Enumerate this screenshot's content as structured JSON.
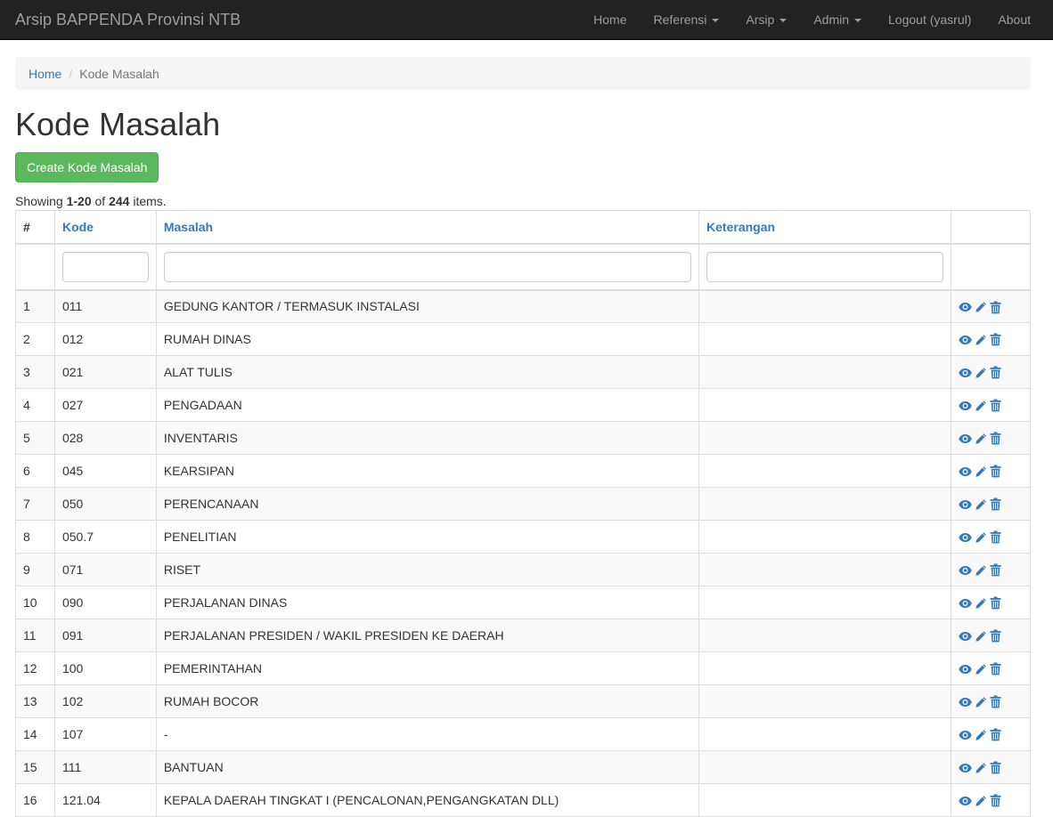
{
  "app": {
    "brand": "Arsip BAPPENDA Provinsi NTB"
  },
  "nav": {
    "items": [
      {
        "label": "Home",
        "dropdown": false
      },
      {
        "label": "Referensi",
        "dropdown": true
      },
      {
        "label": "Arsip",
        "dropdown": true
      },
      {
        "label": "Admin",
        "dropdown": true
      },
      {
        "label": "Logout (yasrul)",
        "dropdown": false
      },
      {
        "label": "About",
        "dropdown": false
      }
    ]
  },
  "breadcrumb": {
    "home": "Home",
    "separator": "/",
    "current": "Kode Masalah"
  },
  "page": {
    "title": "Kode Masalah",
    "create_label": "Create Kode Masalah"
  },
  "summary": {
    "prefix": "Showing ",
    "range": "1-20",
    "of": " of ",
    "total": "244",
    "suffix": " items."
  },
  "table": {
    "headers": {
      "num": "#",
      "kode": "Kode",
      "masalah": "Masalah",
      "keterangan": "Keterangan"
    },
    "rows": [
      {
        "num": "1",
        "kode": "011",
        "masalah": "GEDUNG KANTOR / TERMASUK INSTALASI",
        "keterangan": ""
      },
      {
        "num": "2",
        "kode": "012",
        "masalah": "RUMAH DINAS",
        "keterangan": ""
      },
      {
        "num": "3",
        "kode": "021",
        "masalah": "ALAT TULIS",
        "keterangan": ""
      },
      {
        "num": "4",
        "kode": "027",
        "masalah": "PENGADAAN",
        "keterangan": ""
      },
      {
        "num": "5",
        "kode": "028",
        "masalah": "INVENTARIS",
        "keterangan": ""
      },
      {
        "num": "6",
        "kode": "045",
        "masalah": "KEARSIPAN",
        "keterangan": ""
      },
      {
        "num": "7",
        "kode": "050",
        "masalah": "PERENCANAAN",
        "keterangan": ""
      },
      {
        "num": "8",
        "kode": "050.7",
        "masalah": "PENELITIAN",
        "keterangan": ""
      },
      {
        "num": "9",
        "kode": "071",
        "masalah": "RISET",
        "keterangan": ""
      },
      {
        "num": "10",
        "kode": "090",
        "masalah": "PERJALANAN DINAS",
        "keterangan": ""
      },
      {
        "num": "11",
        "kode": "091",
        "masalah": "PERJALANAN PRESIDEN / WAKIL PRESIDEN KE DAERAH",
        "keterangan": ""
      },
      {
        "num": "12",
        "kode": "100",
        "masalah": "PEMERINTAHAN",
        "keterangan": ""
      },
      {
        "num": "13",
        "kode": "102",
        "masalah": "RUMAH BOCOR",
        "keterangan": ""
      },
      {
        "num": "14",
        "kode": "107",
        "masalah": "-",
        "keterangan": ""
      },
      {
        "num": "15",
        "kode": "111",
        "masalah": "BANTUAN",
        "keterangan": ""
      },
      {
        "num": "16",
        "kode": "121.04",
        "masalah": "KEPALA DAERAH TINGKAT I (PENCALONAN,PENGANGKATAN DLL)",
        "keterangan": ""
      }
    ],
    "actions": [
      "eye-icon",
      "pencil-icon",
      "trash-icon"
    ]
  },
  "colors": {
    "navbar": "#222222",
    "link": "#337ab7",
    "success": "#5cb85c"
  }
}
